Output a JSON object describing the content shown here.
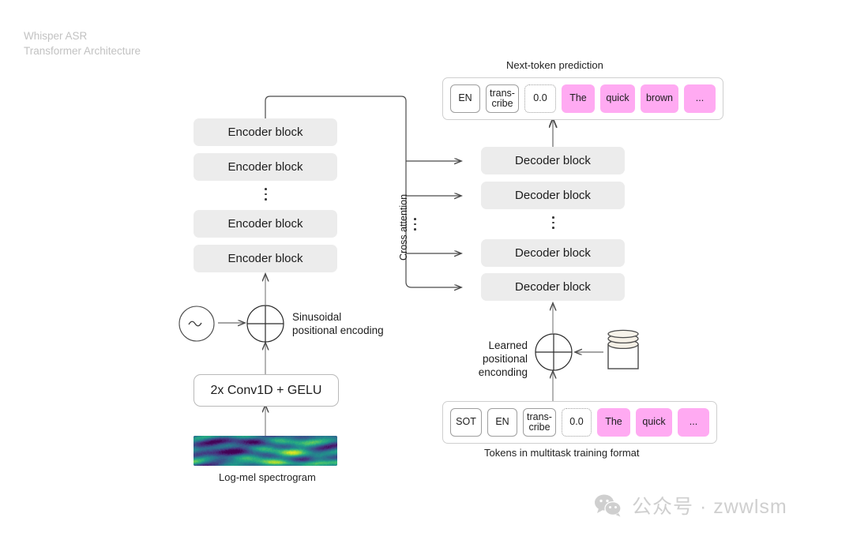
{
  "title": "Whisper ASR\nTransformer Architecture",
  "labels": {
    "next_token_prediction": "Next-token prediction",
    "cross_attention": "Cross attention",
    "sinusoidal_positional_encoding": "Sinusoidal\npositional encoding",
    "learned_positional_encoding": "Learned positional\nenconding",
    "conv_block": "2x Conv1D + GELU",
    "log_mel_spectrogram": "Log-mel spectrogram",
    "tokens_caption": "Tokens in multitask training format",
    "sine_glyph": "~"
  },
  "encoder": {
    "blocks": [
      "Encoder block",
      "Encoder block",
      "Encoder block",
      "Encoder block"
    ],
    "ellipsis_after_index": 1
  },
  "decoder": {
    "blocks": [
      "Decoder block",
      "Decoder block",
      "Decoder block",
      "Decoder block"
    ],
    "ellipsis_after_index": 1
  },
  "output_tokens": [
    {
      "text": "EN",
      "style": "solid"
    },
    {
      "text": "trans-\ncribe",
      "style": "solid"
    },
    {
      "text": "0.0",
      "style": "dotted"
    },
    {
      "text": "The",
      "style": "pink"
    },
    {
      "text": "quick",
      "style": "pink"
    },
    {
      "text": "brown",
      "style": "pink"
    },
    {
      "text": "...",
      "style": "pink"
    }
  ],
  "input_tokens": [
    {
      "text": "SOT",
      "style": "solid"
    },
    {
      "text": "EN",
      "style": "solid"
    },
    {
      "text": "trans-\ncribe",
      "style": "solid"
    },
    {
      "text": "0.0",
      "style": "dotted"
    },
    {
      "text": "The",
      "style": "pink"
    },
    {
      "text": "quick",
      "style": "pink"
    },
    {
      "text": "...",
      "style": "pink"
    }
  ],
  "watermark": {
    "text": "公众号 · zwwlsm",
    "icon": "wechat-icon"
  },
  "colors": {
    "block_gray": "#ececec",
    "token_pink": "#ffaaf2",
    "line": "#4a4a4a",
    "title_gray": "#c2c2c2",
    "watermark_gray": "#cfcfcf",
    "db_cream": "#f5f0e6"
  }
}
